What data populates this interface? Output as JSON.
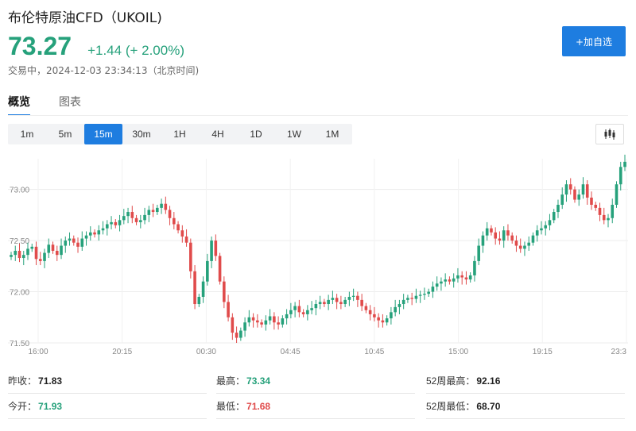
{
  "header": {
    "title": "布伦特原油CFD（UKOIL)",
    "price": "73.27",
    "change": "+1.44 (+ 2.00%)",
    "status": "交易中，2024-12-03 23:34:13（北京时间)",
    "add_button_label": "+加自选"
  },
  "tabs": [
    {
      "label": "概览",
      "active": true
    },
    {
      "label": "图表",
      "active": false
    }
  ],
  "intervals": [
    {
      "label": "1m",
      "active": false
    },
    {
      "label": "5m",
      "active": false
    },
    {
      "label": "15m",
      "active": true
    },
    {
      "label": "30m",
      "active": false
    },
    {
      "label": "1H",
      "active": false
    },
    {
      "label": "4H",
      "active": false
    },
    {
      "label": "1D",
      "active": false
    },
    {
      "label": "1W",
      "active": false
    },
    {
      "label": "1M",
      "active": false
    }
  ],
  "chart_type_icon": "candlestick-icon",
  "colors": {
    "up": "#26a17b",
    "down": "#e04b4b",
    "accent": "#1e7de0"
  },
  "chart_data": {
    "type": "candlestick",
    "x_ticks": [
      "16:00",
      "20:15",
      "00:30",
      "04:45",
      "10:45",
      "15:00",
      "19:15",
      "23:3"
    ],
    "y_ticks": [
      "73.00",
      "72.50",
      "72.00",
      "71.50"
    ],
    "ylim": [
      71.5,
      73.3
    ],
    "grid": true,
    "closes": [
      72.36,
      72.4,
      72.33,
      72.36,
      72.42,
      72.44,
      72.32,
      72.3,
      72.38,
      72.46,
      72.4,
      72.36,
      72.45,
      72.5,
      72.52,
      72.48,
      72.44,
      72.52,
      72.55,
      72.58,
      72.56,
      72.6,
      72.62,
      72.66,
      72.68,
      72.65,
      72.7,
      72.74,
      72.78,
      72.72,
      72.68,
      72.7,
      72.75,
      72.8,
      72.78,
      72.82,
      72.86,
      72.8,
      72.72,
      72.66,
      72.6,
      72.54,
      72.48,
      72.2,
      71.88,
      71.95,
      72.1,
      72.3,
      72.5,
      72.35,
      72.1,
      71.9,
      71.75,
      71.6,
      71.55,
      71.62,
      71.7,
      71.75,
      71.72,
      71.7,
      71.68,
      71.72,
      71.76,
      71.7,
      71.68,
      71.74,
      71.78,
      71.82,
      71.86,
      71.8,
      71.78,
      71.82,
      71.84,
      71.88,
      71.9,
      71.88,
      71.92,
      71.94,
      71.9,
      71.88,
      71.92,
      71.95,
      71.96,
      71.92,
      71.86,
      71.82,
      71.78,
      71.75,
      71.72,
      71.7,
      71.74,
      71.8,
      71.85,
      71.88,
      71.92,
      71.94,
      71.93,
      71.96,
      71.97,
      71.98,
      72.0,
      72.05,
      72.08,
      72.1,
      72.12,
      72.1,
      72.13,
      72.16,
      72.14,
      72.12,
      72.16,
      72.3,
      72.45,
      72.55,
      72.62,
      72.58,
      72.52,
      72.5,
      72.6,
      72.55,
      72.5,
      72.45,
      72.42,
      72.45,
      72.48,
      72.55,
      72.6,
      72.62,
      72.65,
      72.7,
      72.78,
      72.85,
      72.95,
      73.05,
      73.0,
      72.9,
      72.95,
      73.05,
      72.92,
      72.85,
      72.82,
      72.75,
      72.7,
      72.72,
      72.85,
      73.05,
      73.22,
      73.27
    ]
  },
  "stats": [
    [
      {
        "label": "昨收：",
        "value": "71.83",
        "tone": "dark"
      },
      {
        "label": "最高：",
        "value": "73.34",
        "tone": "green"
      },
      {
        "label": "52周最高：",
        "value": "92.16",
        "tone": "dark"
      }
    ],
    [
      {
        "label": "今开：",
        "value": "71.93",
        "tone": "green"
      },
      {
        "label": "最低：",
        "value": "71.68",
        "tone": "red"
      },
      {
        "label": "52周最低：",
        "value": "68.70",
        "tone": "dark"
      }
    ]
  ]
}
